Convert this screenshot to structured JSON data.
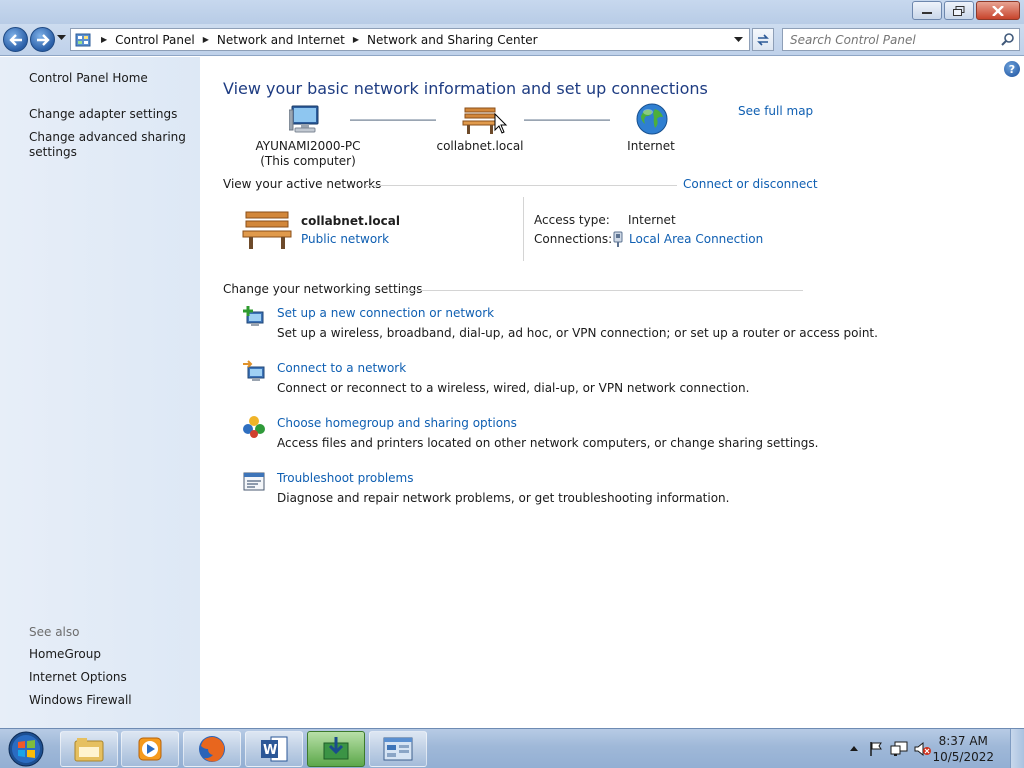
{
  "window": {
    "buttons": [
      "minimize",
      "restore",
      "close"
    ]
  },
  "address_bar": {
    "crumbs": [
      "Control Panel",
      "Network and Internet",
      "Network and Sharing Center"
    ]
  },
  "search": {
    "placeholder": "Search Control Panel"
  },
  "sidebar": {
    "home": "Control Panel Home",
    "links": [
      "Change adapter settings",
      "Change advanced sharing settings"
    ],
    "see_also_label": "See also",
    "see_also": [
      "HomeGroup",
      "Internet Options",
      "Windows Firewall"
    ]
  },
  "main": {
    "help": "?",
    "title": "View your basic network information and set up connections",
    "see_full_map": "See full map",
    "map": {
      "computer_name": "AYUNAMI2000-PC",
      "computer_sub": "(This computer)",
      "network": "collabnet.local",
      "internet": "Internet"
    },
    "active_networks_header": "View your active networks",
    "connect_or_disconnect": "Connect or disconnect",
    "active_network": {
      "name": "collabnet.local",
      "type": "Public network",
      "access_type_label": "Access type:",
      "access_type_value": "Internet",
      "connections_label": "Connections:",
      "connections_value": "Local Area Connection"
    },
    "settings_header": "Change your networking settings",
    "tasks": [
      {
        "link": "Set up a new connection or network",
        "desc": "Set up a wireless, broadband, dial-up, ad hoc, or VPN connection; or set up a router or access point."
      },
      {
        "link": "Connect to a network",
        "desc": "Connect or reconnect to a wireless, wired, dial-up, or VPN network connection."
      },
      {
        "link": "Choose homegroup and sharing options",
        "desc": "Access files and printers located on other network computers, or change sharing settings."
      },
      {
        "link": "Troubleshoot problems",
        "desc": "Diagnose and repair network problems, or get troubleshooting information."
      }
    ]
  },
  "taskbar": {
    "apps": [
      "Windows Explorer",
      "Windows Media Player",
      "Firefox",
      "Microsoft Word",
      "Network app",
      "Control Panel"
    ],
    "time": "8:37 AM",
    "date": "10/5/2022"
  },
  "icons": {
    "back": "back-arrow-icon",
    "forward": "forward-arrow-icon",
    "computer": "computer-icon",
    "bench": "park-bench-icon",
    "globe": "globe-icon"
  }
}
